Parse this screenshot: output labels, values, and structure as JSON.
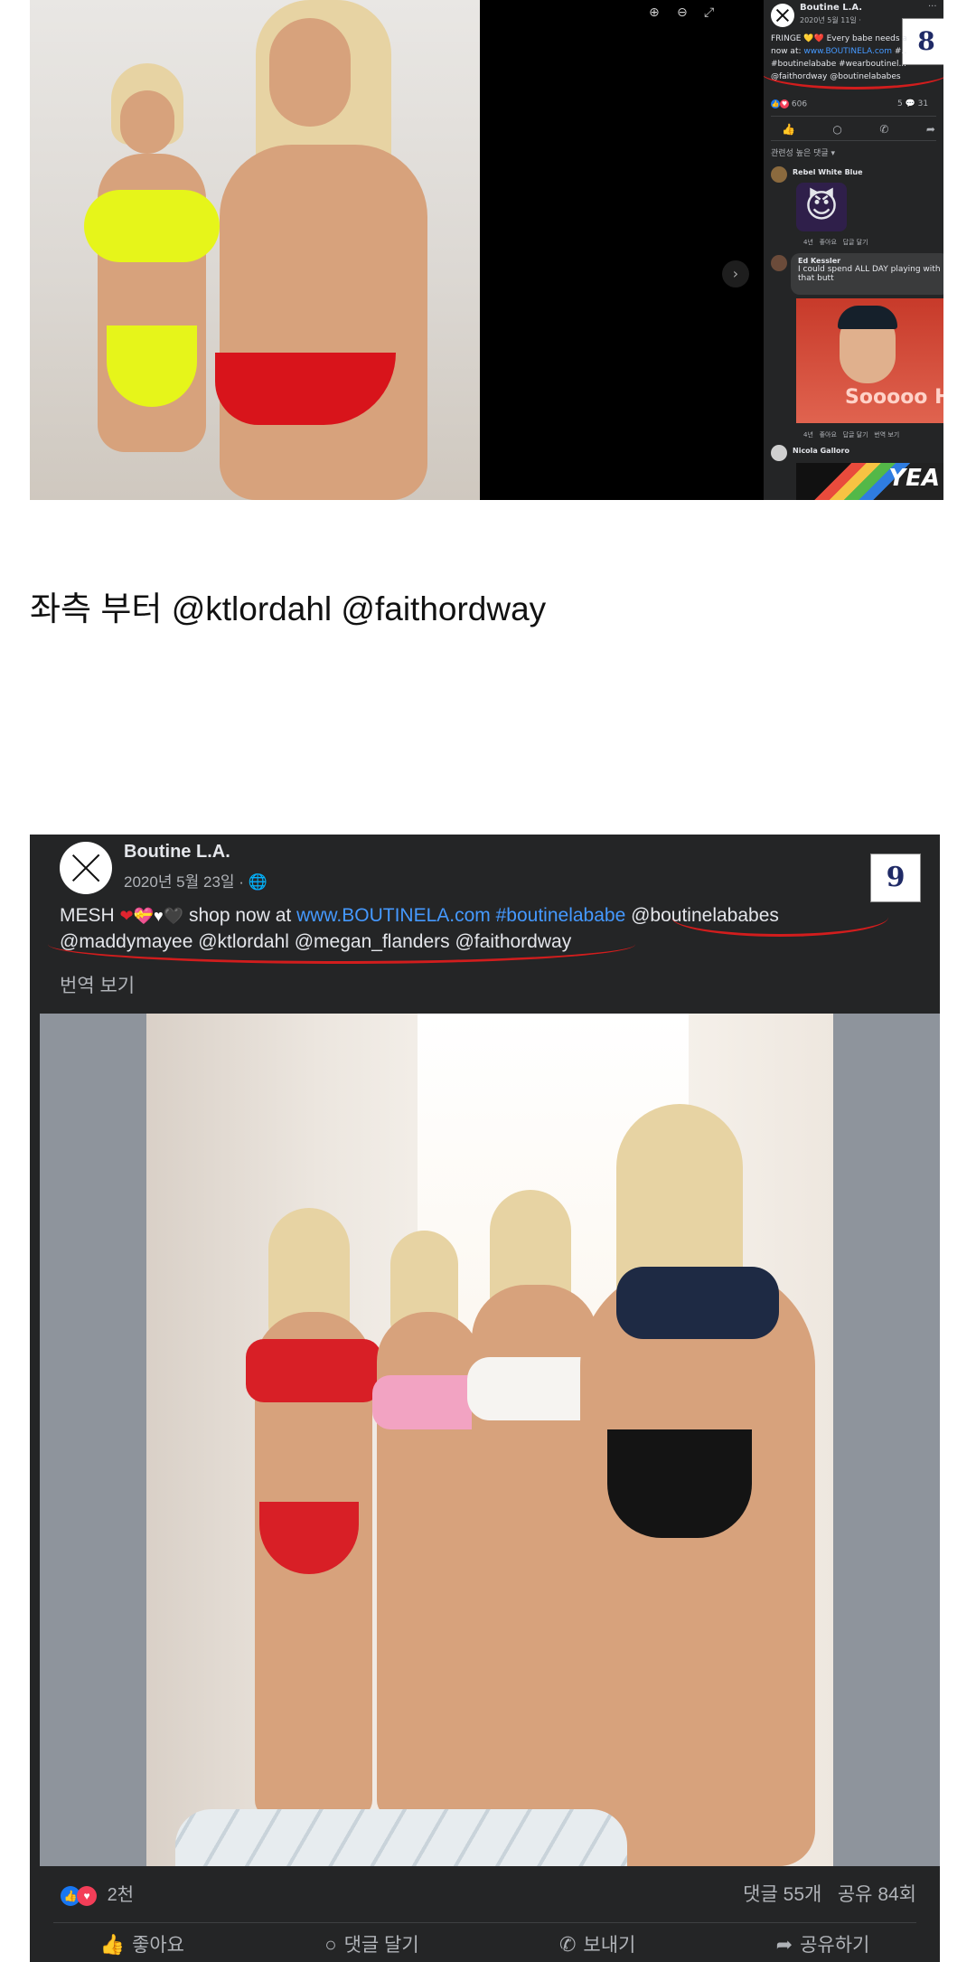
{
  "shot8": {
    "page_name": "Boutine L.A.",
    "date": "2020년 5월 11일 ·",
    "caption_line1": "FRINGE 💛❤️ Every babe needs a fringe shop",
    "caption_line2_prefix": "now at: ",
    "caption_link": "www.BOUTINELA.com",
    "caption_line2_suffix": " #...",
    "caption_line3": "#boutinelababe #wearboutinel...",
    "caption_line4": "@faithordway @boutinelababes",
    "badge": "8",
    "reaction_count": "606",
    "comments_count": "5",
    "shares_count": "31",
    "relevant_comments": "관련성 높은 댓글 ▾",
    "comments": [
      {
        "name": "Rebel White Blue",
        "meta": "4년   좋아요   답글 달기"
      },
      {
        "name": "Ed Kessler",
        "text1": "I could spend ALL DAY playing with",
        "text2": "that butt",
        "meta": "4년   좋아요   답글 달기   번역 보기",
        "gif_text": "Sooooo Ho"
      },
      {
        "name": "Nicola Galloro",
        "gif_text": "YEA"
      }
    ]
  },
  "caption": "좌측 부터 @ktlordahl @faithordway",
  "post9": {
    "page_name": "Boutine L.A.",
    "date": "2020년 5월 23일 · ",
    "badge": "9",
    "text_prefix": "MESH ",
    "text_middle": " shop now at ",
    "link": "www.BOUTINELA.com",
    "hashtag": " #boutinelababe",
    "mention1": " @boutinelababes",
    "line2": "@maddymayee @ktlordahl @megan_flanders @faithordway",
    "translate": "번역 보기",
    "reaction_count": "2천",
    "comments": "댓글 55개",
    "shares": "공유 84회",
    "actions": [
      "좋아요",
      "댓글 달기",
      "보내기",
      "공유하기"
    ]
  },
  "colors": {
    "fb_dark": "#242526",
    "link": "#4599ff",
    "underline": "#d21d1d",
    "badge_text": "#1f2a66"
  }
}
